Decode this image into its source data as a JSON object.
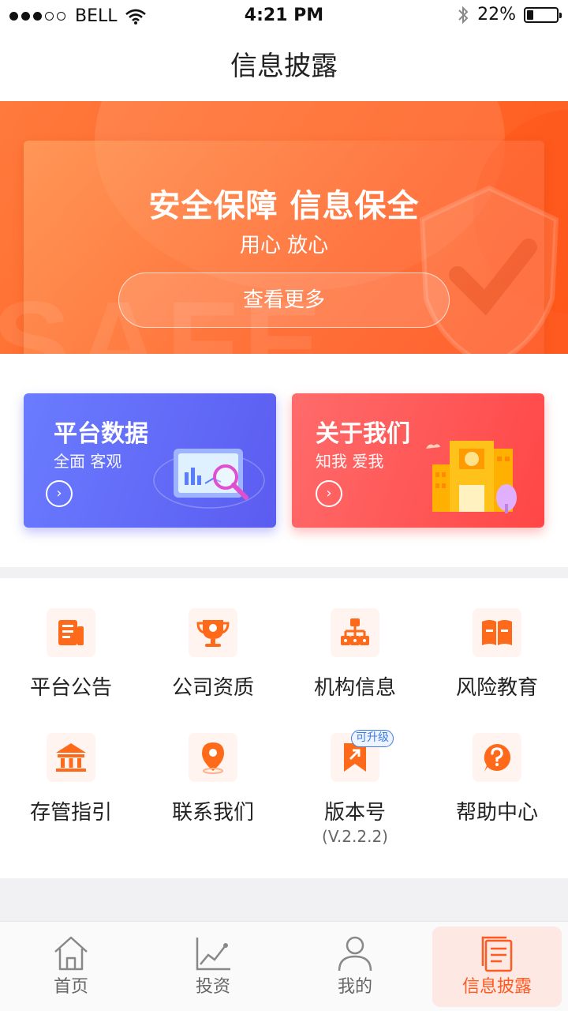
{
  "status_bar": {
    "carrier": "BELL",
    "time": "4:21 PM",
    "battery": "22%",
    "battery_level": 0.22
  },
  "header": {
    "title": "信息披露"
  },
  "hero": {
    "title": "安全保障  信息保全",
    "subtitle": "用心 放心",
    "button_label": "查看更多",
    "background_text": "SAFE"
  },
  "cards": [
    {
      "title": "平台数据",
      "subtitle": "全面 客观",
      "icon": "chevron-right-icon",
      "color": "#5b5cf0"
    },
    {
      "title": "关于我们",
      "subtitle": "知我 爱我",
      "icon": "chevron-right-icon",
      "color": "#ff4646"
    }
  ],
  "grid": [
    {
      "label": "平台公告",
      "icon": "announcement-icon"
    },
    {
      "label": "公司资质",
      "icon": "trophy-icon"
    },
    {
      "label": "机构信息",
      "icon": "org-chart-icon"
    },
    {
      "label": "风险教育",
      "icon": "book-icon"
    },
    {
      "label": "存管指引",
      "icon": "bank-icon"
    },
    {
      "label": "联系我们",
      "icon": "location-icon"
    },
    {
      "label": "版本号",
      "version": "(V.2.2.2)",
      "badge": "可升级",
      "icon": "bookmark-upgrade-icon"
    },
    {
      "label": "帮助中心",
      "icon": "help-icon"
    }
  ],
  "tab_bar": {
    "tabs": [
      {
        "label": "首页",
        "icon": "home-icon",
        "active": false
      },
      {
        "label": "投资",
        "icon": "chart-icon",
        "active": false
      },
      {
        "label": "我的",
        "icon": "user-icon",
        "active": false
      },
      {
        "label": "信息披露",
        "icon": "document-icon",
        "active": true
      }
    ]
  },
  "colors": {
    "accent": "#ff5a1f",
    "icon_bg": "#fff4ef",
    "badge": "#3f7ae0"
  }
}
